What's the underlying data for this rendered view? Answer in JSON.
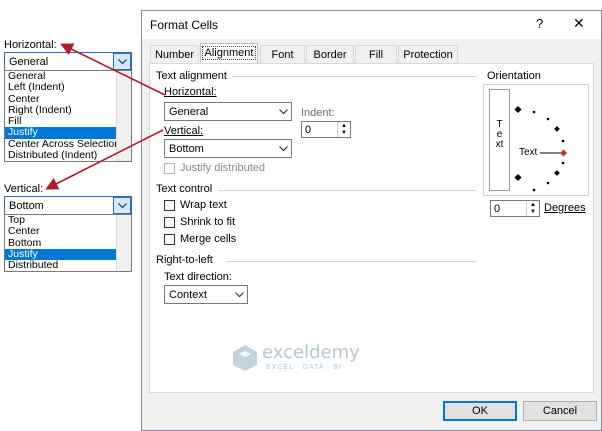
{
  "left_panel": {
    "horizontal": {
      "label": "Horizontal:",
      "selected": "General",
      "options": [
        "General",
        "Left (Indent)",
        "Center",
        "Right (Indent)",
        "Fill",
        "Justify",
        "Center Across Selection",
        "Distributed (Indent)"
      ],
      "highlighted": "Justify"
    },
    "vertical": {
      "label": "Vertical:",
      "selected": "Bottom",
      "options": [
        "Top",
        "Center",
        "Bottom",
        "Justify",
        "Distributed"
      ],
      "highlighted": "Justify"
    }
  },
  "dialog": {
    "title": "Format Cells",
    "help": "?",
    "close": "✕",
    "tabs": [
      "Number",
      "Alignment",
      "Font",
      "Border",
      "Fill",
      "Protection"
    ],
    "active_tab": "Alignment",
    "text_alignment": {
      "heading": "Text alignment",
      "horizontal_label": "Horizontal:",
      "horizontal_value": "General",
      "indent_label": "Indent:",
      "indent_value": "0",
      "vertical_label": "Vertical:",
      "vertical_value": "Bottom",
      "justify_distributed": "Justify distributed"
    },
    "text_control": {
      "heading": "Text control",
      "wrap_text": "Wrap text",
      "shrink_to_fit": "Shrink to fit",
      "merge_cells": "Merge cells"
    },
    "rtl": {
      "heading": "Right-to-left",
      "direction_label": "Text direction:",
      "direction_value": "Context"
    },
    "orientation": {
      "heading": "Orientation",
      "vertical_text": "Text",
      "dial_text": "Text",
      "degrees_value": "0",
      "degrees_label": "Degrees"
    },
    "ok": "OK",
    "cancel": "Cancel"
  },
  "watermark": {
    "name": "exceldemy",
    "tagline": "EXCEL · DATA · BI"
  },
  "colors": {
    "arrow": "#b01c2e",
    "selection": "#0078d7",
    "watermark": "#9bb3c8"
  }
}
